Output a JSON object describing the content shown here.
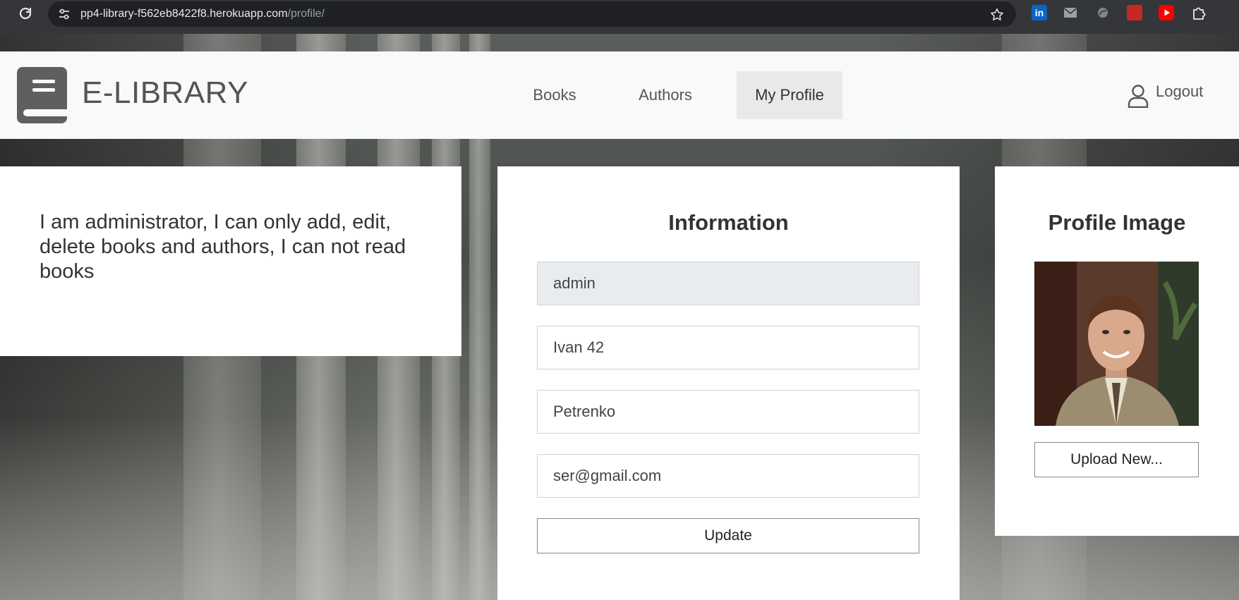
{
  "browser": {
    "url_host": "pp4-library-f562eb8422f8.herokuapp.com",
    "url_path": "/profile/",
    "extensions": [
      "linkedin-icon",
      "mail-icon",
      "circle-icon",
      "book-icon",
      "youtube-icon",
      "puzzle-icon"
    ],
    "linkedin_label": "in"
  },
  "navbar": {
    "brand": "E-LIBRARY",
    "links": [
      {
        "label": "Books",
        "active": false
      },
      {
        "label": "Authors",
        "active": false
      },
      {
        "label": "My Profile",
        "active": true
      }
    ],
    "logout_label": "Logout"
  },
  "note": {
    "text": "I am administrator, I can only add, edit, delete books and authors, I can not read books"
  },
  "information": {
    "title": "Information",
    "username": "admin",
    "first_name": "Ivan 42",
    "last_name": "Petrenko",
    "email": "ser@gmail.com",
    "update_label": "Update"
  },
  "profile_image": {
    "title": "Profile Image",
    "upload_label": "Upload New..."
  },
  "colors": {
    "navbar_bg": "#f8f9fa",
    "active_link_bg": "#e9e9e9",
    "readonly_field_bg": "#e9ecef"
  }
}
